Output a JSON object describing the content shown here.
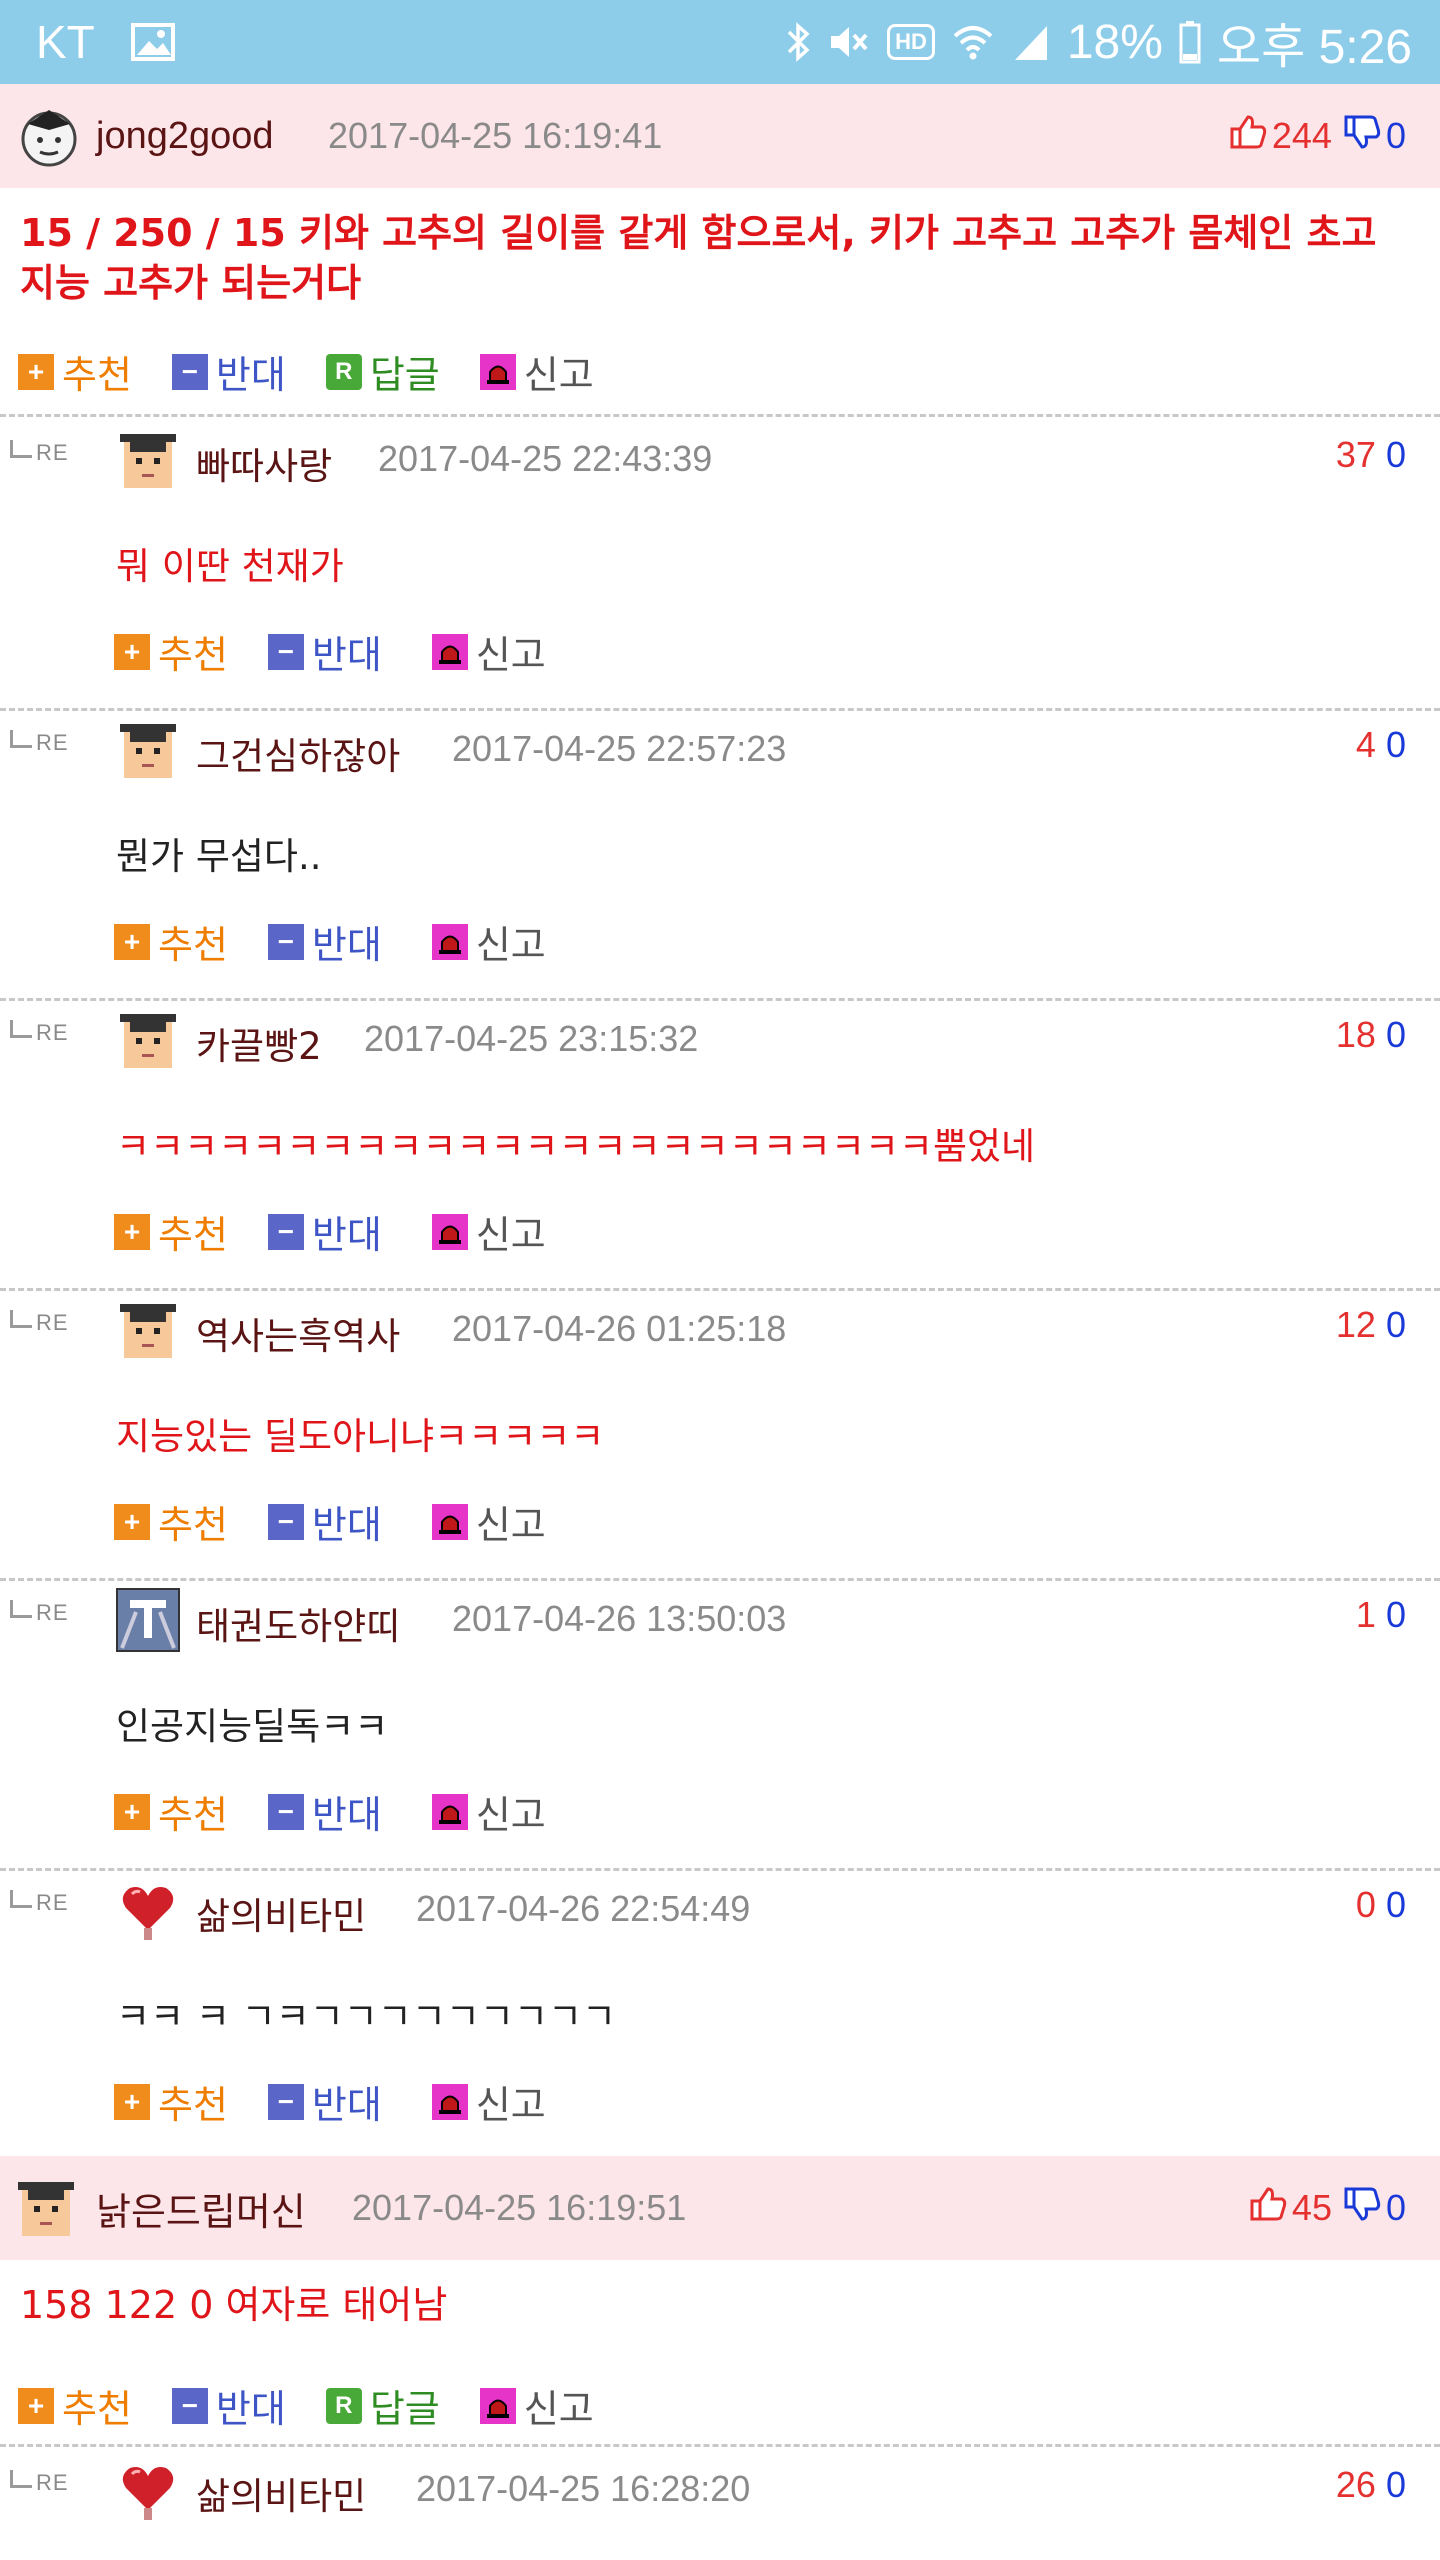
{
  "status_bar": {
    "carrier": "KT",
    "battery": "18%",
    "time": "오후 5:26",
    "hd_label": "HD",
    "icons": [
      "image-icon",
      "bluetooth-icon",
      "mute-icon",
      "hd-icon",
      "wifi-icon",
      "signal-icon",
      "battery-icon"
    ]
  },
  "labels": {
    "recommend": "추천",
    "oppose": "반대",
    "reply": "답글",
    "report": "신고",
    "re": "RE"
  },
  "post1": {
    "nick": "jong2good",
    "date": "2017-04-25 16:19:41",
    "up": "244",
    "down": "0",
    "body": "15 / 250 / 15 키와 고추의 길이를 같게 함으로서, 키가 고추고 고추가 몸체인 초고지능 고추가 되는거다",
    "body_line1": "15 / 250 / 15 키와 고추의 길이를 같게 함으로서, 키가 고추고 고추가 몸체인 초고",
    "body_line2": "지능 고추가 되는거다"
  },
  "replies1": [
    {
      "nick": "빠따사랑",
      "date": "2017-04-25 22:43:39",
      "up": "37",
      "down": "0",
      "body": "뭐 이딴 천재가"
    },
    {
      "nick": "그건심하잖아",
      "date": "2017-04-25 22:57:23",
      "up": "4",
      "down": "0",
      "body": "뭔가 무섭다.."
    },
    {
      "nick": "카끌빵2",
      "date": "2017-04-25 23:15:32",
      "up": "18",
      "down": "0",
      "body": "ㅋㅋㅋㅋㅋㅋㅋㅋㅋㅋㅋㅋㅋㅋㅋㅋㅋㅋㅋㅋㅋㅋㅋㅋ뿜었네"
    },
    {
      "nick": "역사는흑역사",
      "date": "2017-04-26 01:25:18",
      "up": "12",
      "down": "0",
      "body": "지능있는 딜도아니냐ㅋㅋㅋㅋㅋ"
    },
    {
      "nick": "태권도하얀띠",
      "date": "2017-04-26 13:50:03",
      "up": "1",
      "down": "0",
      "body": "인공지능딜독ㅋㅋ"
    },
    {
      "nick": "삶의비타민",
      "date": "2017-04-26 22:54:49",
      "up": "0",
      "down": "0",
      "body": "ㅋㅋ ㅋ ㄱㅋㄱㄱㄱㄱㄱㄱㄱㄱㄱ"
    }
  ],
  "post2": {
    "nick": "낡은드립머신",
    "date": "2017-04-25 16:19:51",
    "up": "45",
    "down": "0",
    "body": "158 122 0 여자로 태어남"
  },
  "replies2": [
    {
      "nick": "삶의비타민",
      "date": "2017-04-25 16:28:20",
      "up": "26",
      "down": "0"
    }
  ]
}
